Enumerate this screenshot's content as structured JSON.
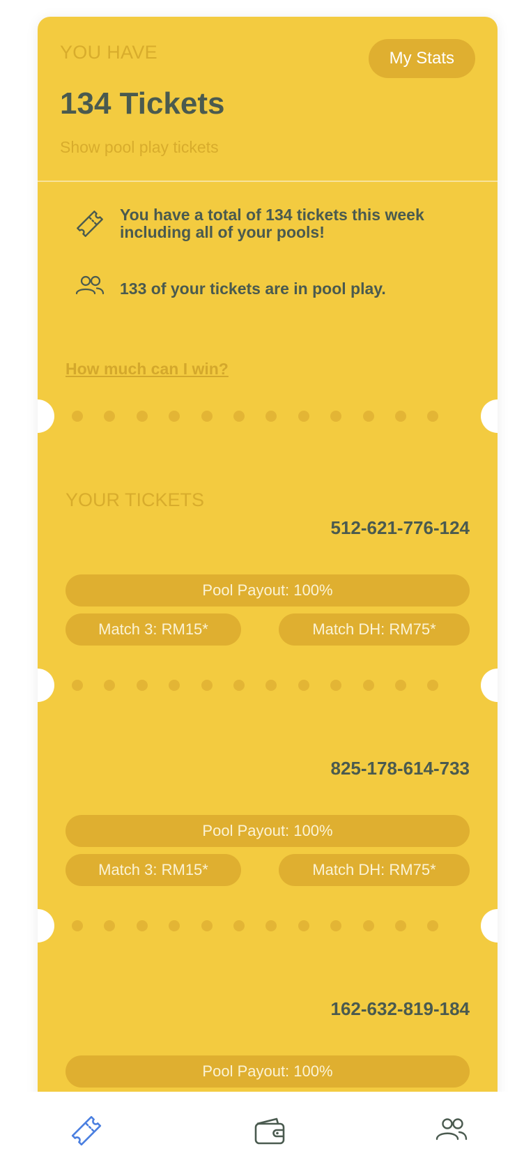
{
  "header": {
    "you_have_label": "YOU HAVE",
    "ticket_count": "134 Tickets",
    "show_pool_link": "Show pool play tickets",
    "my_stats_button": "My Stats"
  },
  "info": {
    "total_message": "You have a total of 134 tickets this week including all of your pools!",
    "pool_message": "133 of your tickets are in pool play.",
    "total_icon": "ticket-icon",
    "pool_icon": "people-icon"
  },
  "win_link": "How much can I win?",
  "tickets_section": {
    "label": "YOUR TICKETS",
    "tickets": [
      {
        "number": "512-621-776-124",
        "pool_payout": "Pool Payout: 100%",
        "match3": "Match 3: RM15*",
        "match_dh": "Match DH: RM75*"
      },
      {
        "number": "825-178-614-733",
        "pool_payout": "Pool Payout: 100%",
        "match3": "Match 3: RM15*",
        "match_dh": "Match DH: RM75*"
      },
      {
        "number": "162-632-819-184",
        "pool_payout": "Pool Payout: 100%"
      }
    ]
  },
  "tabbar": {
    "tabs": [
      {
        "icon": "ticket-icon",
        "active": true
      },
      {
        "icon": "wallet-icon",
        "active": false
      },
      {
        "icon": "people-icon",
        "active": false
      }
    ]
  },
  "colors": {
    "card_background": "#F3CB40",
    "pill_background": "#DFAF30",
    "primary_text": "#4A5A4F",
    "muted_text": "#D8AC2C",
    "active_tab": "#4A7FE0",
    "inactive_tab": "#4A5A4F"
  }
}
